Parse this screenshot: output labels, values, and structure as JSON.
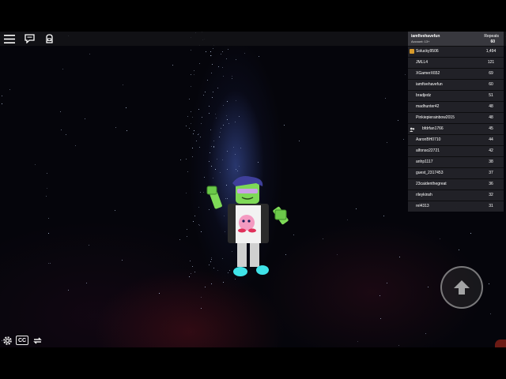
{
  "topbar": {
    "menu_icon": "hamburger-menu-icon",
    "chat_icon": "chat-icon",
    "backpack_icon": "backpack-icon"
  },
  "leaderboard": {
    "username": "iamfivehavefun",
    "account_label": "Account: 13+",
    "stat_label": "Repeats",
    "stat_value": "60",
    "players": [
      {
        "name": "Solucky9506",
        "score": "1,494",
        "marker": "leader-icon"
      },
      {
        "name": "JMLL4",
        "score": "121"
      },
      {
        "name": "XGamerX652",
        "score": "69"
      },
      {
        "name": "iamfivehavefun",
        "score": "60"
      },
      {
        "name": "bradjedz",
        "score": "51"
      },
      {
        "name": "madhunter42",
        "score": "48"
      },
      {
        "name": "Pinkiepierainbow2015",
        "score": "48"
      },
      {
        "name": "bfdrfan1766",
        "score": "45",
        "marker": "friend-icon"
      },
      {
        "name": "AaronBH0710",
        "score": "44"
      },
      {
        "name": "alfonso22721",
        "score": "42"
      },
      {
        "name": "anhp1117",
        "score": "38"
      },
      {
        "name": "guest_2317453",
        "score": "37"
      },
      {
        "name": "23caidenthegreat",
        "score": "36"
      },
      {
        "name": "rileykinsh",
        "score": "32"
      },
      {
        "name": "rel4313",
        "score": "31"
      }
    ]
  },
  "controls": {
    "settings_icon": "gear-icon",
    "captions_label": "CC",
    "swap_icon": "swap-arrows-icon",
    "jump_icon": "up-arrow-icon"
  },
  "colors": {
    "leader_marker": "#d79a2b",
    "skin": "#7ed957",
    "hair": "#3f3f9a",
    "shoes": "#3fe3e8"
  }
}
